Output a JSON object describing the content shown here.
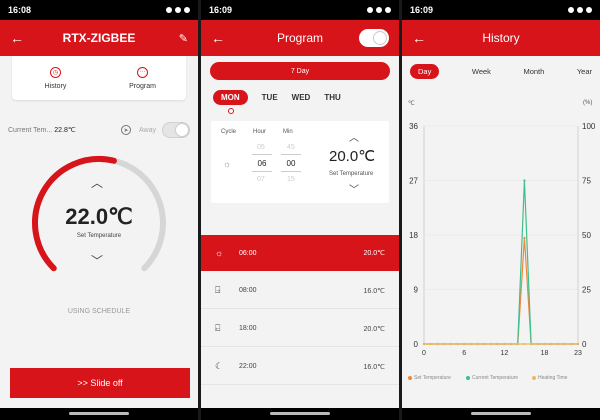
{
  "screen1": {
    "status_time": "16:08",
    "title": "RTX-ZIGBEE",
    "tabs": [
      {
        "label": "History"
      },
      {
        "label": "Program"
      }
    ],
    "current_temp_label": "Current Tem...",
    "current_temp_value": "22.8℃",
    "away_label": "Away",
    "setpoint": "22.0℃",
    "set_temp_label": "Set Temperature",
    "setpoint_fraction": 0.55,
    "using_schedule": "USING SCHEDULE",
    "slide_off": ">> Slide off"
  },
  "screen2": {
    "status_time": "16:09",
    "title": "Program",
    "program_enabled": true,
    "mode_label": "7 Day",
    "days": [
      "MON",
      "TUE",
      "WED",
      "THU"
    ],
    "picker": {
      "cycle_label": "Cycle",
      "hour_label": "Hour",
      "min_label": "Min",
      "hour_prev": "05",
      "hour": "06",
      "hour_next": "07",
      "min_prev": "45",
      "min": "00",
      "min_next": "15",
      "temp": "20.0℃",
      "temp_label": "Set Temperature"
    },
    "schedule": [
      {
        "icon": "sun-icon",
        "time": "06:00",
        "temp": "20.0℃",
        "active": true
      },
      {
        "icon": "door-out-icon",
        "time": "08:00",
        "temp": "16.0℃",
        "active": false
      },
      {
        "icon": "door-in-icon",
        "time": "18:00",
        "temp": "20.0℃",
        "active": false
      },
      {
        "icon": "moon-icon",
        "time": "22:00",
        "temp": "16.0℃",
        "active": false
      }
    ]
  },
  "screen3": {
    "status_time": "16:09",
    "title": "History",
    "tabs": [
      "Day",
      "Week",
      "Month",
      "Year"
    ],
    "active_tab": "Day"
  },
  "chart_data": {
    "type": "line",
    "left_unit": "℃",
    "right_unit": "(%)",
    "left_ticks": [
      "36",
      "27",
      "18",
      "9",
      "0"
    ],
    "right_ticks": [
      "100",
      "75",
      "50",
      "25",
      "0"
    ],
    "x_ticks": [
      "0",
      "6",
      "12",
      "18",
      "23"
    ],
    "ylim_left": [
      0,
      36
    ],
    "ylim_right": [
      0,
      100
    ],
    "xlim": [
      0,
      23
    ],
    "x": [
      0,
      1,
      2,
      3,
      4,
      5,
      6,
      7,
      8,
      9,
      10,
      11,
      12,
      13,
      14,
      15,
      16,
      17,
      18,
      19,
      20,
      21,
      22,
      23
    ],
    "series": [
      {
        "name": "Set Temperature",
        "color": "#f0873c",
        "axis": "left",
        "values": [
          0,
          0,
          0,
          0,
          0,
          0,
          0,
          0,
          0,
          0,
          0,
          0,
          0,
          0,
          0,
          17.5,
          0,
          0,
          0,
          0,
          0,
          0,
          0,
          0
        ]
      },
      {
        "name": "Current Temperature",
        "color": "#3fbf8c",
        "axis": "left",
        "values": [
          0,
          0,
          0,
          0,
          0,
          0,
          0,
          0,
          0,
          0,
          0,
          0,
          0,
          0,
          0,
          27,
          0,
          0,
          0,
          0,
          0,
          0,
          0,
          0
        ]
      },
      {
        "name": "Heating Time",
        "color": "#f2b45a",
        "axis": "right",
        "values": [
          0,
          0,
          0,
          0,
          0,
          0,
          0,
          0,
          0,
          0,
          0,
          0,
          0,
          0,
          0,
          0,
          0,
          0,
          0,
          0,
          0,
          0,
          0,
          0
        ]
      }
    ]
  }
}
